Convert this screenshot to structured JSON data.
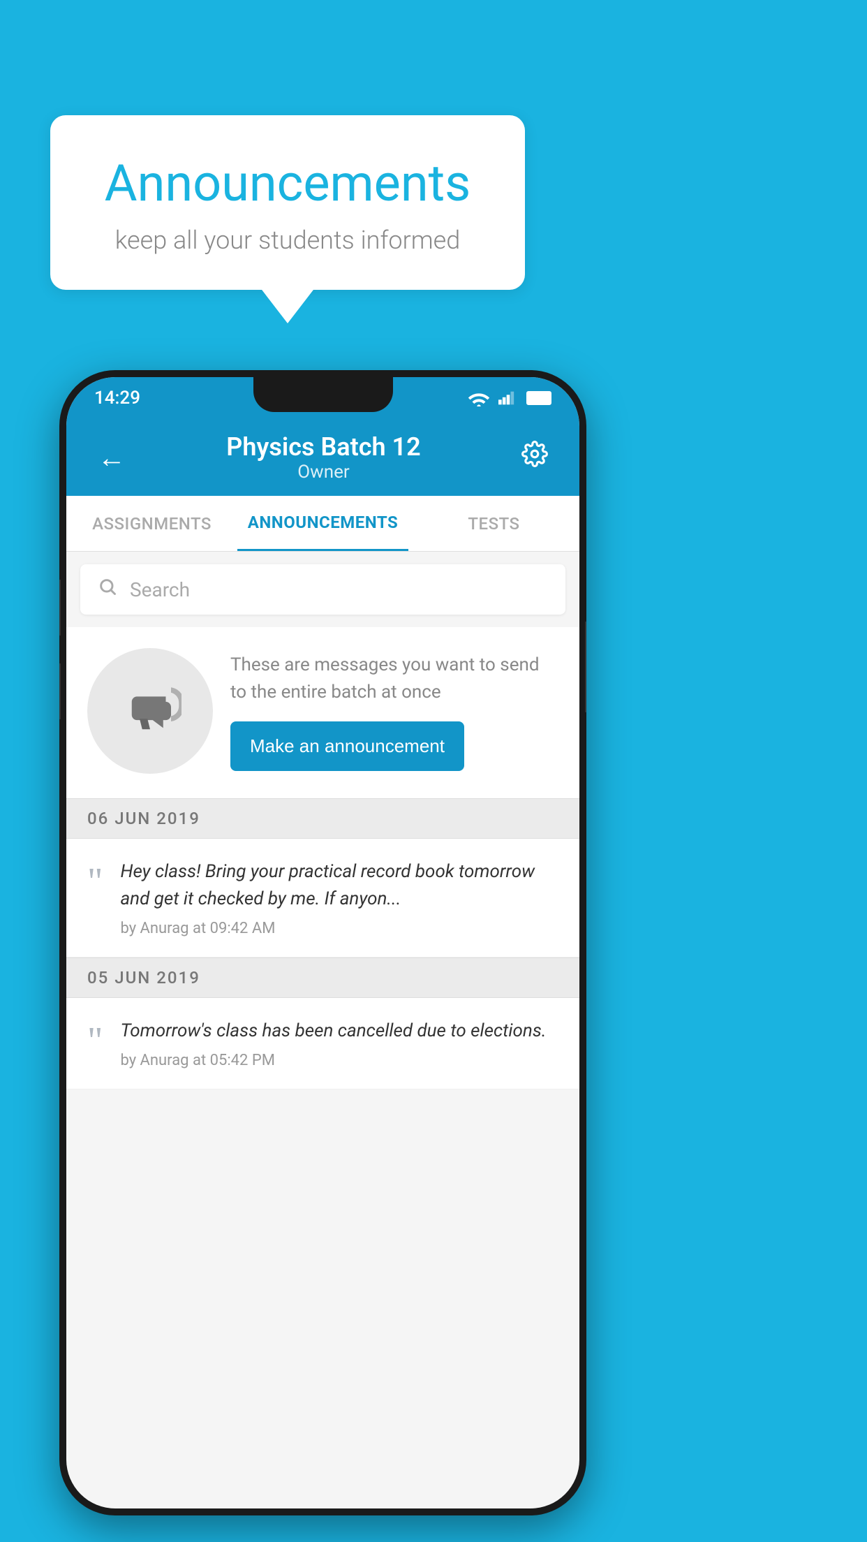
{
  "background_color": "#1ab3e0",
  "speech_bubble": {
    "title": "Announcements",
    "subtitle": "keep all your students informed"
  },
  "status_bar": {
    "time": "14:29",
    "wifi": true,
    "signal": true,
    "battery": true
  },
  "header": {
    "title": "Physics Batch 12",
    "subtitle": "Owner",
    "back_label": "←",
    "settings_label": "⚙"
  },
  "tabs": [
    {
      "label": "ASSIGNMENTS",
      "active": false
    },
    {
      "label": "ANNOUNCEMENTS",
      "active": true
    },
    {
      "label": "TESTS",
      "active": false
    }
  ],
  "search": {
    "placeholder": "Search"
  },
  "promo": {
    "description": "These are messages you want to send to the entire batch at once",
    "button_label": "Make an announcement"
  },
  "announcements": [
    {
      "date": "06  JUN  2019",
      "text": "Hey class! Bring your practical record book tomorrow and get it checked by me. If anyon...",
      "meta": "by Anurag at 09:42 AM"
    },
    {
      "date": "05  JUN  2019",
      "text": "Tomorrow's class has been cancelled due to elections.",
      "meta": "by Anurag at 05:42 PM"
    }
  ]
}
